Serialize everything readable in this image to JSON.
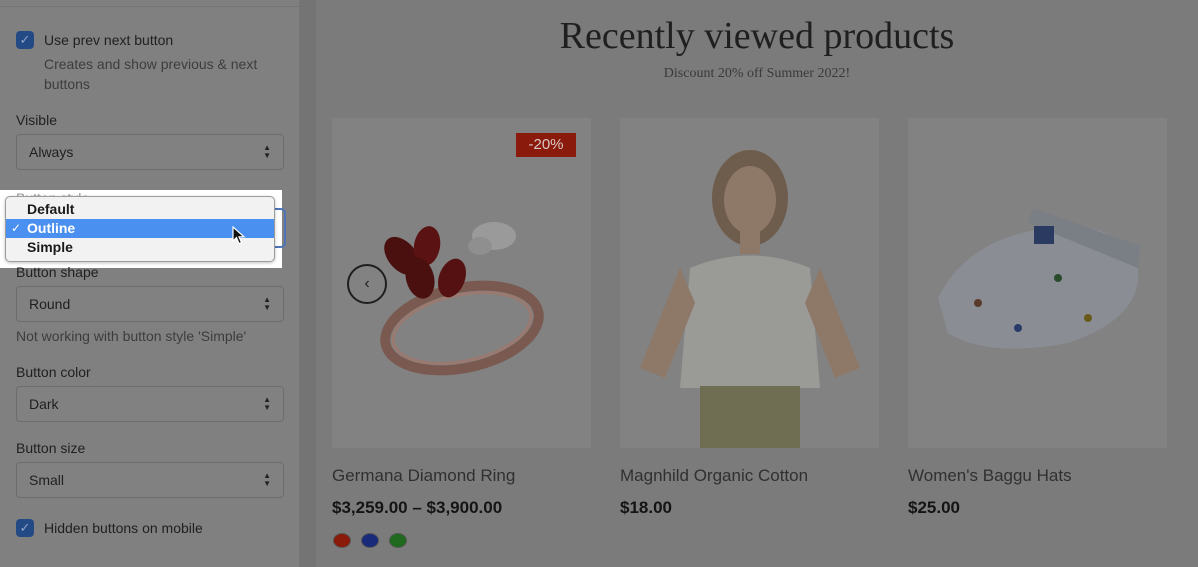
{
  "panel": {
    "use_prev_next": {
      "label": "Use prev next button",
      "checked": true,
      "help": "Creates and show previous & next buttons"
    },
    "visible": {
      "label": "Visible",
      "value": "Always"
    },
    "button_style": {
      "label": "Button style",
      "options": [
        "Default",
        "Outline",
        "Simple"
      ],
      "selected": "Outline"
    },
    "button_shape": {
      "label": "Button shape",
      "value": "Round",
      "help": "Not working with button style 'Simple'"
    },
    "button_color": {
      "label": "Button color",
      "value": "Dark"
    },
    "button_size": {
      "label": "Button size",
      "value": "Small"
    },
    "hidden_on_mobile": {
      "label": "Hidden buttons on mobile",
      "checked": true
    }
  },
  "content": {
    "title": "Recently viewed products",
    "subtitle": "Discount 20% off Summer 2022!",
    "products": [
      {
        "name": "Germana Diamond Ring",
        "price": "$3,259.00 – $3,900.00",
        "badge": "-20%",
        "swatch_colors": [
          "#8a1a0a",
          "#1a2a7a",
          "#1f6a1f"
        ]
      },
      {
        "name": "Magnhild Organic Cotton",
        "price": "$18.00"
      },
      {
        "name": "Women's Baggu Hats",
        "price": "$25.00"
      }
    ]
  },
  "colors": {
    "selected_option": "#4a90f0",
    "checkbox": "#244a85",
    "badge": "#8a1a0b"
  }
}
